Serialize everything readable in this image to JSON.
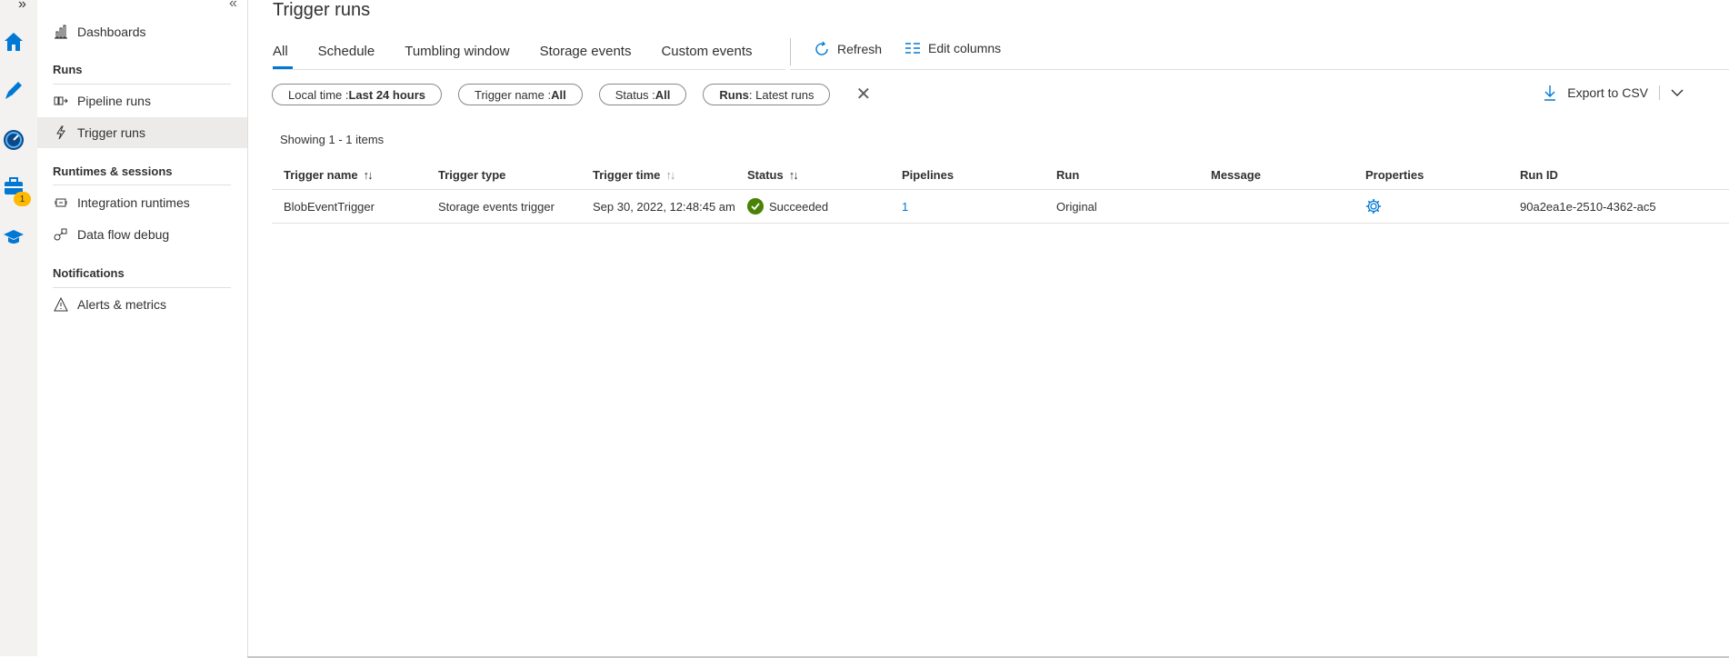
{
  "rail": {
    "expand_glyph": "»",
    "items": [
      {
        "name": "home-icon",
        "color": "#0078d4"
      },
      {
        "name": "pencil-icon",
        "color": "#0078d4"
      },
      {
        "name": "monitor-icon",
        "color": "#0078d4"
      },
      {
        "name": "toolbox-icon",
        "color": "#0078d4",
        "badge": "1"
      },
      {
        "name": "learn-icon",
        "color": "#0078d4"
      }
    ]
  },
  "nav": {
    "collapse_glyph": "«",
    "dashboards": "Dashboards",
    "section_runs": "Runs",
    "pipeline_runs": "Pipeline runs",
    "trigger_runs": "Trigger runs",
    "section_runtimes": "Runtimes & sessions",
    "integration_runtimes": "Integration runtimes",
    "data_flow_debug": "Data flow debug",
    "section_notifications": "Notifications",
    "alerts_metrics": "Alerts & metrics"
  },
  "page": {
    "title": "Trigger runs",
    "tabs": [
      "All",
      "Schedule",
      "Tumbling window",
      "Storage events",
      "Custom events"
    ],
    "active_tab": "All",
    "refresh": "Refresh",
    "edit_columns": "Edit columns",
    "export": "Export to CSV"
  },
  "filters": [
    {
      "key": "Local time : ",
      "value": "Last 24 hours"
    },
    {
      "key": "Trigger name : ",
      "value": "All"
    },
    {
      "key": "Status : ",
      "value": "All"
    },
    {
      "key": "Runs",
      "value": " : Latest runs"
    }
  ],
  "showing": "Showing 1 - 1 items",
  "table": {
    "headers": [
      "Trigger name",
      "Trigger type",
      "Trigger time",
      "Status",
      "Pipelines",
      "Run",
      "Message",
      "Properties",
      "Run ID"
    ],
    "rows": [
      {
        "trigger_name": "BlobEventTrigger",
        "trigger_type": "Storage events trigger",
        "trigger_time": "Sep 30, 2022, 12:48:45 am",
        "status": "Succeeded",
        "pipelines": "1",
        "run": "Original",
        "message": "",
        "properties_icon": "gear-icon",
        "run_id": "90a2ea1e-2510-4362-ac5"
      }
    ]
  },
  "colors": {
    "accent": "#0078d4",
    "success": "#498205",
    "badge": "#ffb900"
  }
}
